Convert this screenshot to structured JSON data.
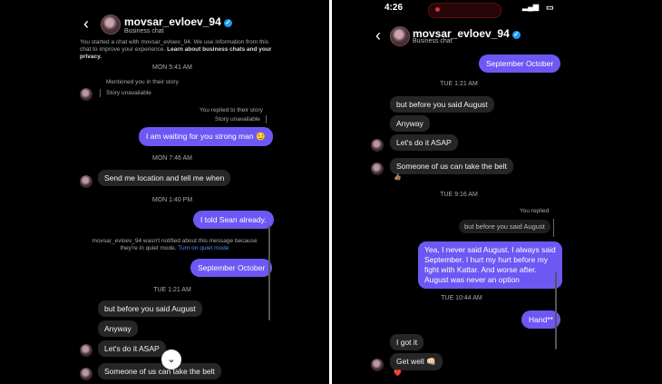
{
  "left": {
    "header": {
      "back": "‹",
      "name": "movsar_evloev_94",
      "verified": "✓",
      "subtitle": "Business chat"
    },
    "info_text": "You started a chat with movsar_evloev_94. We use information from this chat to improve your experience.",
    "info_link": "Learn about business chats and your privacy.",
    "times": [
      "MON 5:41 AM",
      "MON 7:46 AM",
      "MON 1:40 PM",
      "TUE 1:21 AM"
    ],
    "mentioned": "Mentioned you in their story",
    "story_unavailable_in": "Story unavailable",
    "replied_to_story": "You replied to their story",
    "story_unavailable_out": "Story unavailable",
    "msg_waiting": "I am waiting for you strong man 😏",
    "msg_location": "Send me location and tell me when",
    "msg_sean": "I told Sean already.",
    "quiet_text": "movsar_evloev_94 wasn't notified about this message because they're in quiet mode.",
    "quiet_link": "Turn on quiet mode",
    "msg_sept_oct": "September October",
    "msg_before_august": "but before you said August",
    "msg_anyway": "Anyway",
    "msg_asap": "Let's do it ASAP",
    "msg_belt": "Someone of us can take the belt",
    "scroll_down": "⌄"
  },
  "right": {
    "status": {
      "time": "4:26",
      "signal": "▂▄▆",
      "battery": "▭"
    },
    "header": {
      "back": "‹",
      "name": "movsar_evloev_94",
      "verified": "✓",
      "subtitle": "Business chat"
    },
    "msg_sept_oct": "September October",
    "times": [
      "TUE 1:21 AM",
      "TUE 9:16 AM",
      "TUE 10:44 AM"
    ],
    "msg_before_august": "but before you said August",
    "msg_anyway": "Anyway",
    "msg_asap": "Let's do it ASAP",
    "msg_belt": "Someone of us can take the belt",
    "belt_reaction": "👍🏽",
    "you_replied": "You replied",
    "quoted": "but before you said August",
    "msg_long_1": "Yea, I never said August. I always said",
    "msg_long_2": "September. I hurt my hurt before my",
    "msg_long_3": "fight with Kattar. And worse after.",
    "msg_long_4": "August was never an option",
    "msg_hand": "Hand**",
    "msg_got_it": "I got it",
    "msg_get_well": "Get well 👊🏻",
    "get_well_reaction": "❤️"
  }
}
